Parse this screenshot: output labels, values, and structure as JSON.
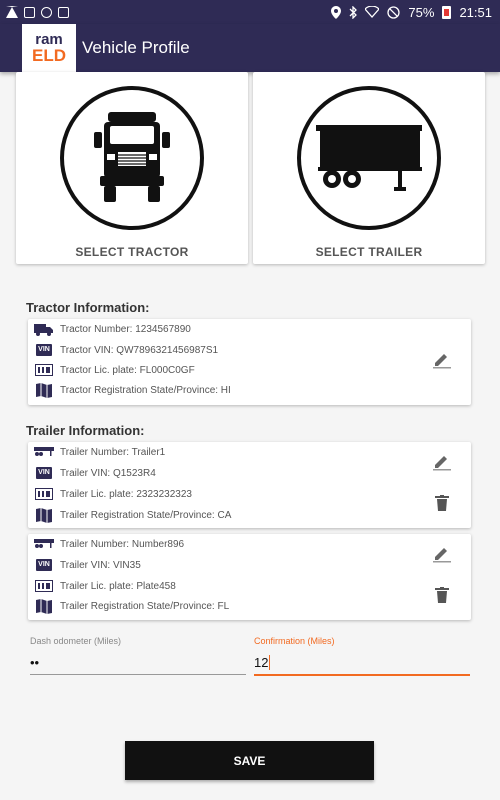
{
  "status_bar": {
    "battery": "75%",
    "time": "21:51"
  },
  "app_bar": {
    "logo_top": "ram",
    "logo_bottom": "ELD",
    "title": "Vehicle Profile"
  },
  "selectors": {
    "tractor_label": "SELECT TRACTOR",
    "trailer_label": "SELECT TRAILER"
  },
  "tractor_section": {
    "title": "Tractor Information:",
    "number": "Tractor Number: 1234567890",
    "vin": "Tractor VIN: QW7896321456987S1",
    "plate": "Tractor Lic. plate: FL000C0GF",
    "registration": "Tractor Registration State/Province: HI"
  },
  "trailer_section": {
    "title": "Trailer Information:",
    "trailers": [
      {
        "number": "Trailer Number: Trailer1",
        "vin": "Trailer VIN: Q1523R4",
        "plate": "Trailer Lic. plate: 2323232323",
        "registration": "Trailer Registration State/Province: CA"
      },
      {
        "number": "Trailer Number: Number896",
        "vin": "Trailer VIN: VIN35",
        "plate": "Trailer Lic. plate: Plate458",
        "registration": "Trailer Registration State/Province: FL"
      }
    ]
  },
  "odometer": {
    "dash_label": "Dash odometer (Miles)",
    "dash_value": "••",
    "confirm_label": "Confirmation (Miles)",
    "confirm_value": "12"
  },
  "vin_badge": "VIN",
  "save_label": "SAVE",
  "colors": {
    "primary": "#2f2b55",
    "accent": "#f26a21",
    "button": "#111111"
  },
  "icons": [
    "location-icon",
    "bluetooth-icon",
    "wifi-icon",
    "do-not-disturb-icon",
    "battery-icon",
    "truck-icon",
    "trailer-icon",
    "vin-icon",
    "plate-icon",
    "map-icon",
    "edit-icon",
    "delete-icon"
  ]
}
